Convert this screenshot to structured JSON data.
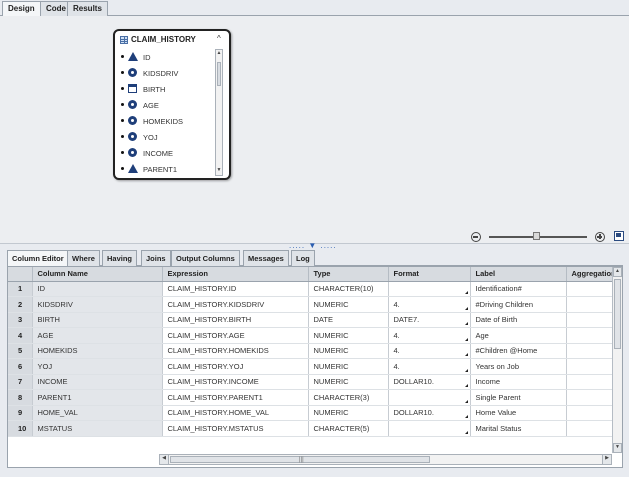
{
  "top_tabs": [
    {
      "label": "Design",
      "active": true
    },
    {
      "label": "Code",
      "active": false
    },
    {
      "label": "Results",
      "active": false
    }
  ],
  "table_card": {
    "title": "CLAIM_HISTORY",
    "collapse_glyph": "^",
    "columns": [
      {
        "name": "ID",
        "type_icon": "character-icon"
      },
      {
        "name": "KIDSDRIV",
        "type_icon": "numeric-icon"
      },
      {
        "name": "BIRTH",
        "type_icon": "date-icon"
      },
      {
        "name": "AGE",
        "type_icon": "numeric-icon"
      },
      {
        "name": "HOMEKIDS",
        "type_icon": "numeric-icon"
      },
      {
        "name": "YOJ",
        "type_icon": "numeric-icon"
      },
      {
        "name": "INCOME",
        "type_icon": "numeric-icon"
      },
      {
        "name": "PARENT1",
        "type_icon": "character-icon"
      }
    ]
  },
  "splitter_glyph": "..... ▼ .....",
  "zoom": {
    "level_fraction": 0.48
  },
  "bottom_tabs": [
    {
      "label": "Column Editor",
      "active": true
    },
    {
      "label": "Where",
      "active": false
    },
    {
      "label": "Having",
      "active": false
    },
    {
      "label": "Joins",
      "active": false
    },
    {
      "label": "Output Columns",
      "active": false
    },
    {
      "label": "Messages",
      "active": false
    },
    {
      "label": "Log",
      "active": false
    }
  ],
  "grid": {
    "headers": [
      "",
      "Column Name",
      "Expression",
      "Type",
      "Format",
      "Label",
      "Aggregation"
    ],
    "rows": [
      [
        "1",
        "ID",
        "CLAIM_HISTORY.ID",
        "CHARACTER(10)",
        "",
        "Identification#",
        ""
      ],
      [
        "2",
        "KIDSDRIV",
        "CLAIM_HISTORY.KIDSDRIV",
        "NUMERIC",
        "4.",
        "#Driving Children",
        ""
      ],
      [
        "3",
        "BIRTH",
        "CLAIM_HISTORY.BIRTH",
        "DATE",
        "DATE7.",
        "Date of Birth",
        ""
      ],
      [
        "4",
        "AGE",
        "CLAIM_HISTORY.AGE",
        "NUMERIC",
        "4.",
        "Age",
        ""
      ],
      [
        "5",
        "HOMEKIDS",
        "CLAIM_HISTORY.HOMEKIDS",
        "NUMERIC",
        "4.",
        "#Children @Home",
        ""
      ],
      [
        "6",
        "YOJ",
        "CLAIM_HISTORY.YOJ",
        "NUMERIC",
        "4.",
        "Years on Job",
        ""
      ],
      [
        "7",
        "INCOME",
        "CLAIM_HISTORY.INCOME",
        "NUMERIC",
        "DOLLAR10.",
        "Income",
        ""
      ],
      [
        "8",
        "PARENT1",
        "CLAIM_HISTORY.PARENT1",
        "CHARACTER(3)",
        "",
        "Single Parent",
        ""
      ],
      [
        "9",
        "HOME_VAL",
        "CLAIM_HISTORY.HOME_VAL",
        "NUMERIC",
        "DOLLAR10.",
        "Home Value",
        ""
      ],
      [
        "10",
        "MSTATUS",
        "CLAIM_HISTORY.MSTATUS",
        "CHARACTER(5)",
        "",
        "Marital Status",
        ""
      ]
    ]
  },
  "scroll_glyphs": {
    "up": "▲",
    "down": "▼",
    "left": "◀",
    "right": "▶",
    "grip": "|||"
  }
}
